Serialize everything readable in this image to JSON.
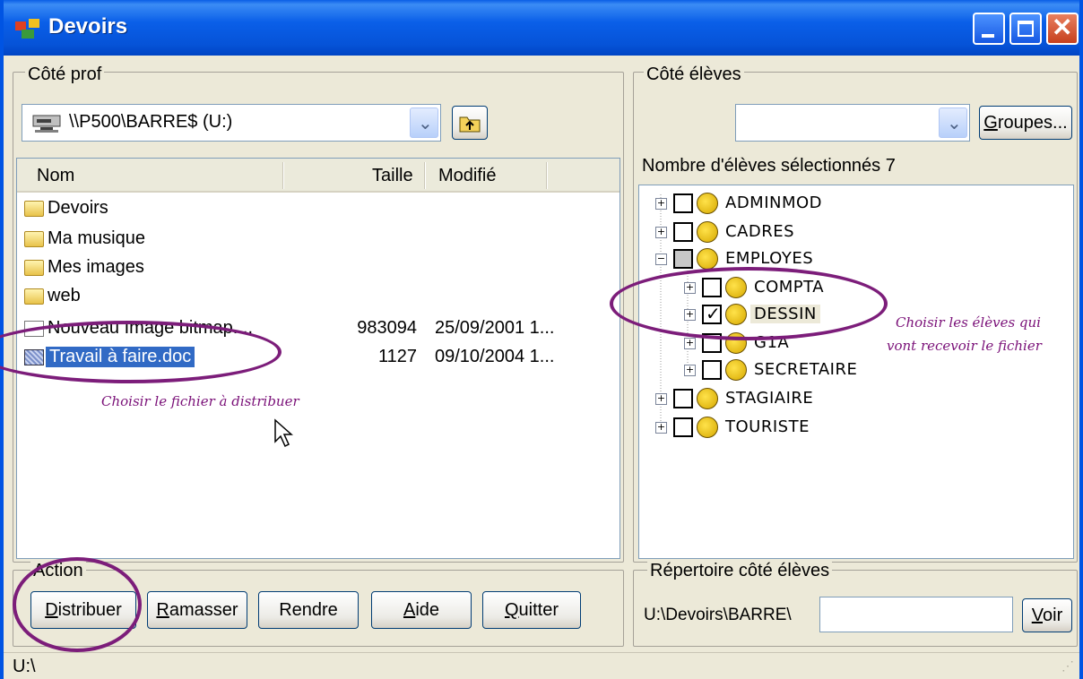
{
  "window": {
    "title": "Devoirs"
  },
  "teacher_panel": {
    "legend": "Côté prof",
    "drive_value": "\\\\P500\\BARRE$ (U:)",
    "columns": [
      "Nom",
      "Taille",
      "Modifié"
    ],
    "files": [
      {
        "name": "Devoirs",
        "size": "",
        "date": "",
        "kind": "folder"
      },
      {
        "name": "Ma musique",
        "size": "",
        "date": "",
        "kind": "folder"
      },
      {
        "name": "Mes images",
        "size": "",
        "date": "",
        "kind": "folder"
      },
      {
        "name": "web",
        "size": "",
        "date": "",
        "kind": "folder"
      },
      {
        "name": "Nouveau Image bitmap....",
        "size": "983094",
        "date": "25/09/2001 1...",
        "kind": "file"
      },
      {
        "name": "Travail à faire.doc",
        "size": "1127",
        "date": "09/10/2004 1...",
        "kind": "doc",
        "selected": true
      }
    ],
    "annotation": "Choisir le fichier à distribuer"
  },
  "action_panel": {
    "legend": "Action",
    "buttons": {
      "distribuer": {
        "first": "D",
        "rest": "istribuer"
      },
      "ramasser": {
        "first": "R",
        "rest": "amasser"
      },
      "rendre": "Rendre",
      "aide": {
        "first": "A",
        "rest": "ide"
      },
      "quitter": {
        "first": "Q",
        "rest": "uitter"
      }
    }
  },
  "student_panel": {
    "legend": "Côté élèves",
    "groups_button": {
      "first": "G",
      "rest": "roupes..."
    },
    "selected_count_label": "Nombre d'élèves sélectionnés 7",
    "tree": [
      {
        "label": "ADMINMOD",
        "state": "unchecked",
        "expander": "+"
      },
      {
        "label": "CADRES",
        "state": "unchecked",
        "expander": "+"
      },
      {
        "label": "EMPLOYES",
        "state": "partial",
        "expander": "−"
      },
      {
        "label": "COMPTA",
        "state": "unchecked",
        "expander": "+"
      },
      {
        "label": "DESSIN",
        "state": "checked",
        "expander": "+"
      },
      {
        "label": "G1A",
        "state": "unchecked",
        "expander": "+"
      },
      {
        "label": "SECRETAIRE",
        "state": "unchecked",
        "expander": "+"
      },
      {
        "label": "STAGIAIRE",
        "state": "unchecked",
        "expander": "+"
      },
      {
        "label": "TOURISTE",
        "state": "unchecked",
        "expander": "+"
      }
    ],
    "annotation_line1": "Choisir les élèves qui",
    "annotation_line2": "vont recevoir le fichier"
  },
  "student_dir_panel": {
    "legend": "Répertoire côté élèves",
    "path_prefix": "U:\\Devoirs\\BARRE\\",
    "path_value": "",
    "voir_button": {
      "first": "V",
      "rest": "oir"
    }
  },
  "statusbar": {
    "text": "U:\\"
  },
  "icons": [
    "app-icon",
    "minimize-icon",
    "maximize-icon",
    "close-icon",
    "drive-icon",
    "folder-up-icon",
    "chevron-down-icon",
    "folder-icon",
    "file-icon",
    "doc-icon",
    "group-icon",
    "mouse-cursor-icon"
  ]
}
